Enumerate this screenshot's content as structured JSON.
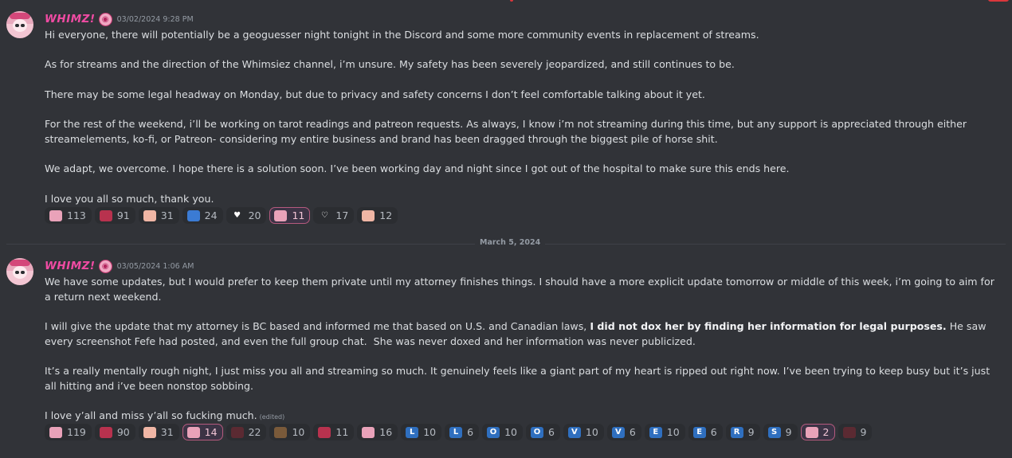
{
  "messages": [
    {
      "username": "WHIMZ!",
      "timestamp": "03/02/2024 9:28 PM",
      "paragraphs": [
        "Hi everyone, there will potentially be a geoguesser night tonight in the Discord and some more community events in replacement of streams.",
        "As for streams and the direction of the Whimsiez channel, i’m unsure. My safety has been severely jeopardized, and still continues to be.",
        "There may be some legal headway on Monday, but due to privacy and safety concerns I don’t feel comfortable talking about it yet.",
        "For the rest of the weekend, i’ll be working on tarot readings and patreon requests. As always, I know i’m not streaming during this time, but any support is appreciated through either streamelements, ko-fi, or Patreon- considering my entire business and brand has been dragged through the biggest pile of horse shit.",
        "We adapt, we overcome. I hope there is a solution soon. I’ve been working day and night since I got out of the hospital to make sure this ends here.",
        "I love you all so much, thank you."
      ],
      "reactions": [
        {
          "icon": "pink-character-emoji",
          "count": "113"
        },
        {
          "icon": "red-character-emoji",
          "count": "91"
        },
        {
          "icon": "peach-character-emoji",
          "count": "31"
        },
        {
          "icon": "blue-figure-emoji",
          "count": "24"
        },
        {
          "icon": "purple-heart-emoji",
          "count": "20"
        },
        {
          "icon": "pink-character-emoji",
          "count": "11"
        },
        {
          "icon": "heart-hands-emoji",
          "count": "17"
        },
        {
          "icon": "peach-character-emoji",
          "count": "12"
        }
      ]
    },
    {
      "username": "WHIMZ!",
      "timestamp": "03/05/2024 1:06 AM",
      "p1": "We have some updates, but I would prefer to keep them private until my attorney finishes things. I should have a more explicit update tomorrow or middle of this week, i’m going to aim for a return next weekend.",
      "p2_pre": "I will give the update that my attorney is BC based and informed me that based on U.S. and Canadian laws, ",
      "p2_bold": "I did not dox her by finding her information for legal purposes.",
      "p2_post": " He saw every screenshot Fefe had posted, and even the full group chat.  She was never doxed and her information was never publicized.",
      "p3": "It’s a really mentally rough night, I just miss you all and streaming so much. It genuinely feels like a giant part of my heart is ripped out right now. I’ve been trying to keep busy but it’s just all hitting and i’ve been nonstop sobbing.",
      "p4": "I love y’all and miss y’all so fucking much.",
      "edited": "(edited)",
      "reactions": [
        {
          "icon": "pink-character-emoji",
          "count": "119"
        },
        {
          "icon": "red-character-emoji",
          "count": "90"
        },
        {
          "icon": "peach-character-emoji",
          "count": "31"
        },
        {
          "icon": "pink-character-emoji",
          "count": "14"
        },
        {
          "icon": "dark-character-emoji",
          "count": "22"
        },
        {
          "icon": "brown-creature-emoji",
          "count": "10"
        },
        {
          "icon": "red-figure-emoji",
          "count": "11"
        },
        {
          "icon": "pink-character-emoji",
          "count": "16"
        },
        {
          "letter": "L",
          "count": "10"
        },
        {
          "letter": "L",
          "count": "6"
        },
        {
          "letter": "O",
          "count": "10"
        },
        {
          "letter": "O",
          "count": "6"
        },
        {
          "letter": "V",
          "count": "10"
        },
        {
          "letter": "V",
          "count": "6"
        },
        {
          "letter": "E",
          "count": "10"
        },
        {
          "letter": "E",
          "count": "6"
        },
        {
          "letter": "R",
          "count": "9"
        },
        {
          "letter": "S",
          "count": "9"
        },
        {
          "icon": "pink-character-emoji",
          "count": "2"
        },
        {
          "icon": "dark-character-emoji",
          "count": "9"
        }
      ]
    }
  ],
  "divider": {
    "label": "March 5, 2024"
  },
  "colors": {
    "username": "#f04ba3",
    "background": "#313338",
    "reaction_active_border": "#b55a7e"
  }
}
